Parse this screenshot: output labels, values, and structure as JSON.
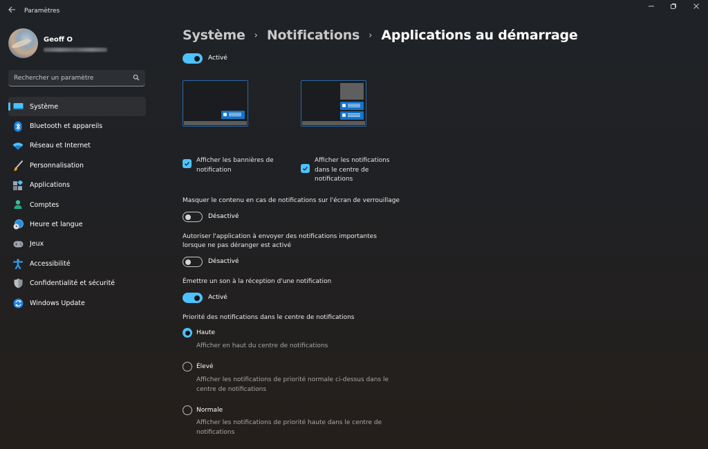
{
  "window": {
    "title": "Paramètres",
    "controls": {
      "minimize": "–",
      "maximize": "❐",
      "close": "✕"
    }
  },
  "profile": {
    "name": "Geoff O",
    "email_hidden": true
  },
  "search": {
    "placeholder": "Rechercher un paramètre",
    "value": ""
  },
  "sidebar": {
    "items": [
      {
        "label": "Système",
        "icon": "monitor-icon",
        "active": true
      },
      {
        "label": "Bluetooth et appareils",
        "icon": "bluetooth-icon"
      },
      {
        "label": "Réseau et Internet",
        "icon": "wifi-icon"
      },
      {
        "label": "Personnalisation",
        "icon": "brush-icon"
      },
      {
        "label": "Applications",
        "icon": "apps-icon"
      },
      {
        "label": "Comptes",
        "icon": "person-icon"
      },
      {
        "label": "Heure et langue",
        "icon": "globe-clock-icon"
      },
      {
        "label": "Jeux",
        "icon": "gamepad-icon"
      },
      {
        "label": "Accessibilité",
        "icon": "accessibility-icon"
      },
      {
        "label": "Confidentialité et sécurité",
        "icon": "shield-icon"
      },
      {
        "label": "Windows Update",
        "icon": "update-icon"
      }
    ]
  },
  "breadcrumb": {
    "items": [
      "Système",
      "Notifications",
      "Applications au démarrage"
    ],
    "separator": "›"
  },
  "main": {
    "master_toggle": {
      "state": "on",
      "label": "Activé"
    },
    "previews": [
      {
        "name": "banner-preview",
        "toasts": 1
      },
      {
        "name": "notification-center-preview",
        "toasts": 2
      }
    ],
    "checkboxes": [
      {
        "label": "Afficher les bannières de notification",
        "checked": true
      },
      {
        "label": "Afficher les notifications dans le centre de notifications",
        "checked": true
      }
    ],
    "settings": [
      {
        "label": "Masquer le contenu en cas de notifications sur l'écran de verrouillage",
        "toggle_state": "off",
        "toggle_label": "Désactivé"
      },
      {
        "label": "Autoriser l'application à envoyer des notifications importantes lorsque ne pas déranger est activé",
        "toggle_state": "off",
        "toggle_label": "Désactivé"
      },
      {
        "label": "Émettre un son à la réception d'une notification",
        "toggle_state": "on",
        "toggle_label": "Activé"
      }
    ],
    "priority": {
      "label": "Priorité des notifications dans le centre de notifications",
      "selected": "Haute",
      "options": [
        {
          "label": "Haute",
          "description": "Afficher en haut du centre de notifications",
          "selected": true
        },
        {
          "label": "Élevé",
          "description": "Afficher les notifications de priorité normale ci-dessus dans le centre de notifications",
          "selected": false
        },
        {
          "label": "Normale",
          "description": "Afficher les notifications de priorité haute dans le centre de notifications",
          "selected": false
        }
      ]
    }
  },
  "colors": {
    "accent": "#4cc2ff",
    "preview_toast": "#1673c8",
    "background_top": "#1f2226",
    "background_bottom": "#241f1b"
  }
}
